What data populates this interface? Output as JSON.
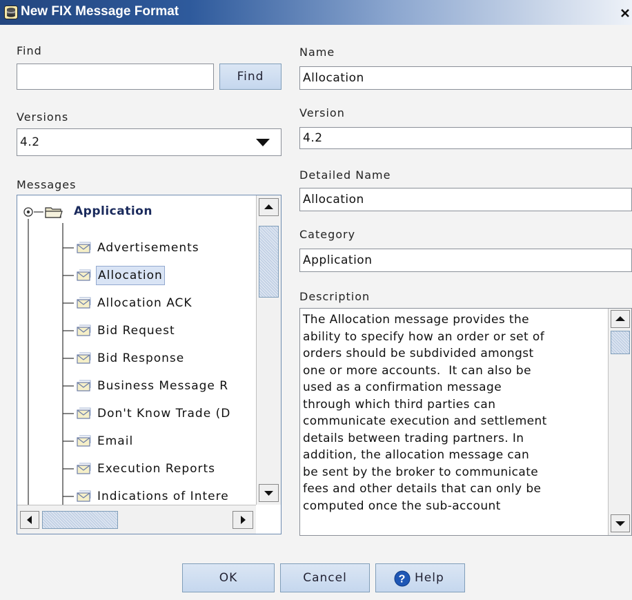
{
  "window": {
    "title": "New FIX Message Format"
  },
  "find": {
    "label": "Find",
    "value": "",
    "button": "Find"
  },
  "versions": {
    "label": "Versions",
    "selected": "4.2"
  },
  "messages": {
    "label": "Messages",
    "root": "Application",
    "items": [
      "Advertisements",
      "Allocation",
      "Allocation ACK",
      "Bid Request",
      "Bid Response",
      "Business Message R",
      "Don't Know Trade (D",
      "Email",
      "Execution Reports",
      "Indications of Intere"
    ],
    "selected_index": 1
  },
  "form": {
    "name_label": "Name",
    "name_value": "Allocation",
    "version_label": "Version",
    "version_value": "4.2",
    "detailed_label": "Detailed Name",
    "detailed_value": "Allocation",
    "category_label": "Category",
    "category_value": "Application",
    "description_label": "Description",
    "description_lines": [
      "The Allocation message provides the",
      "ability to specify how an order or set of",
      "orders should be subdivided amongst",
      "one or more accounts.  It can also be",
      "used as a confirmation message",
      "through which third parties can",
      "communicate execution and settlement",
      "details between trading partners. In",
      "addition, the allocation message can",
      "be sent by the broker to communicate",
      "fees and other details that can only be",
      "computed once the sub-account"
    ]
  },
  "buttons": {
    "ok": "OK",
    "cancel": "Cancel",
    "help": "Help"
  },
  "icons": {
    "window": "database-icon",
    "close": "close-icon",
    "folder": "folder-open-icon",
    "message": "envelope-icon",
    "help": "help-circle-icon",
    "dropdown": "triangle-down-icon"
  },
  "colors": {
    "titlebar": "#2e5a9c",
    "selection": "#d9e4f5",
    "help_icon": "#1f57b5"
  }
}
